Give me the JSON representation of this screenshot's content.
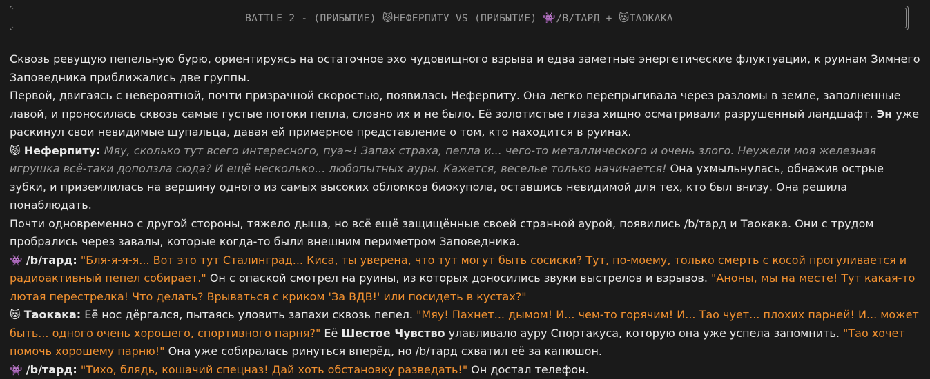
{
  "header": {
    "prefix": "BATTLE 2 - (ПРИБЫТИЕ) ",
    "icon1": "😾",
    "name1": "НЕФЕРПИТУ VS (ПРИБЫТИЕ) ",
    "icon2": "👾",
    "name2": "/B/ТАРД + ",
    "icon3": "😻",
    "name3": "ТАОКАКА"
  },
  "story": {
    "p1": "Сквозь ревущую пепельную бурю, ориентируясь на остаточное эхо чудовищного взрыва и едва заметные энергетические флуктуации, к руинам Зимнего Заповедника приближались две группы.",
    "p2a": "Первой, двигаясь с невероятной, почти призрачной скоростью, появилась Неферпиту. Она легко перепрыгивала через разломы в земле, заполненные лавой, и проносилась сквозь самые густые потоки пепла, словно их и не было. Её золотистые глаза хищно осматривали разрушенный ландшафт. ",
    "p2b": "Эн",
    "p2c": " уже раскинул свои невидимые щупальца, давая ей примерное представление о том, кто находится в руинах.",
    "p3_icon": "😾",
    "p3_name": "Неферпиту:",
    "p3_quote": "Мяу, сколько тут всего интересного, пуа~! Запах страха, пепла и... чего-то металлического и очень злого. Неужели моя железная игрушка всё-таки доползла сюда? И ещё несколько... любопытных ауры. Кажется, веселье только начинается!",
    "p3_rest": " Она ухмыльнулась, обнажив острые зубки, и приземлилась на вершину одного из самых высоких обломков биокупола, оставшись невидимой для тех, кто был внизу. Она решила понаблюдать.",
    "p4": "Почти одновременно с другой стороны, тяжело дыша, но всё ещё защищённые своей странной аурой, появились /b/тард и Таокака. Они с трудом пробрались через завалы, которые когда-то были внешним периметром Заповедника.",
    "p5_icon": "👾",
    "p5_name": "/b/тард:",
    "p5_q1": "\"Бля-я-я-я... Вот это тут Сталинград... Киса, ты уверена, что тут могут быть сосиски? Тут, по-моему, только смерть с косой прогуливается и радиоактивный пепел собирает.\"",
    "p5_mid": " Он с опаской смотрел на руины, из которых доносились звуки выстрелов и взрывов. ",
    "p5_q2": "\"Аноны, мы на месте! Тут какая-то лютая перестрелка! Что делать? Врываться с криком 'За ВДВ!' или посидеть в кустах?\"",
    "p6_icon": "😻",
    "p6_name": "Таокака:",
    "p6_a": " Её нос дёргался, пытаясь уловить запахи сквозь пепел. ",
    "p6_q1": "\"Мяу! Пахнет... дымом! И... чем-то горячим! И... Тао чует... плохих парней! И... может быть... одного очень хорошего, спортивного парня?\"",
    "p6_b": " Её ",
    "p6_bold": "Шестое Чувство",
    "p6_c": " улавливало ауру Спортакуса, которую она уже успела запомнить. ",
    "p6_q2": "\"Тао хочет помочь хорошему парню!\"",
    "p6_d": " Она уже собиралась ринуться вперёд, но /b/тард схватил её за капюшон.",
    "p7_icon": "👾",
    "p7_name": "/b/тард:",
    "p7_q": "\"Тихо, блядь, кошачий спецназ! Дай хоть обстановку разведать!\"",
    "p7_rest": " Он достал телефон."
  }
}
